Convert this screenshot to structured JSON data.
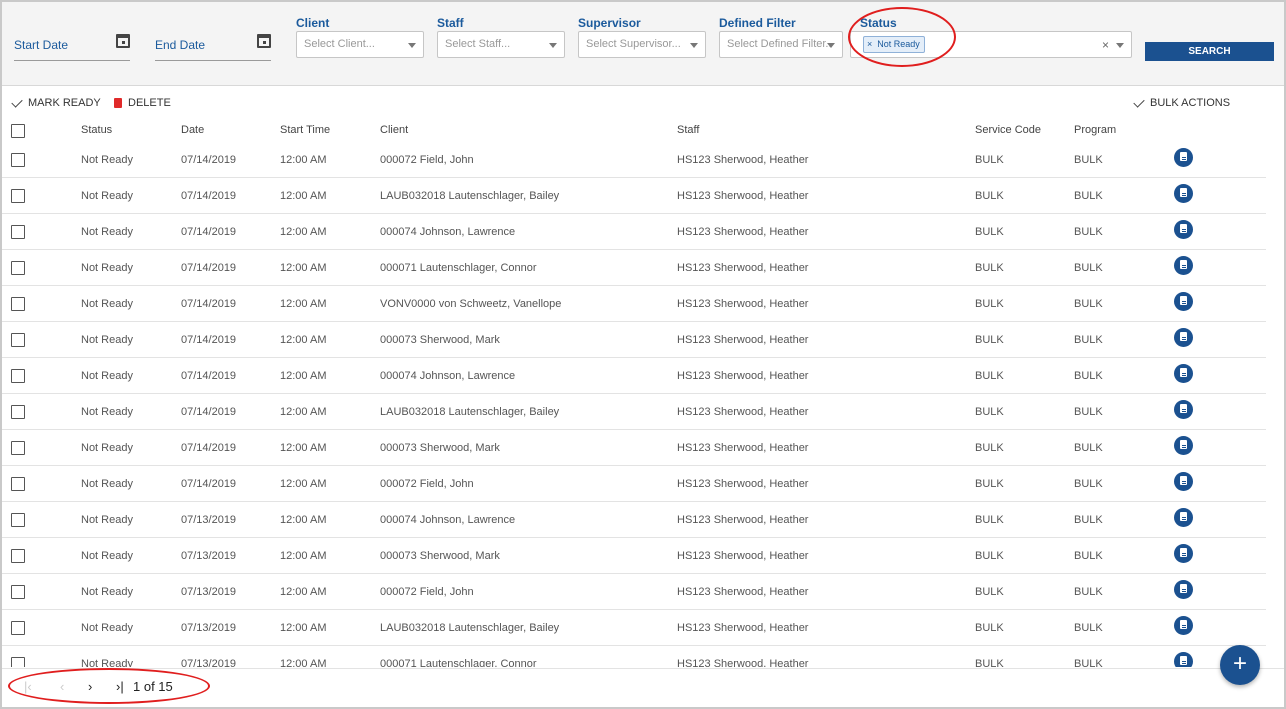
{
  "filters": {
    "start_date": {
      "label": "Start Date"
    },
    "end_date": {
      "label": "End Date"
    },
    "client": {
      "label": "Client",
      "placeholder": "Select Client..."
    },
    "staff": {
      "label": "Staff",
      "placeholder": "Select Staff..."
    },
    "supervisor": {
      "label": "Supervisor",
      "placeholder": "Select Supervisor..."
    },
    "defined_filter": {
      "label": "Defined Filter",
      "placeholder": "Select Defined Filter..."
    },
    "status": {
      "label": "Status",
      "tag": "Not Ready",
      "tag_remove": "×",
      "clear": "×"
    },
    "search_label": "SEARCH"
  },
  "toolbar": {
    "mark_ready": "MARK READY",
    "delete": "DELETE",
    "bulk_actions": "BULK ACTIONS"
  },
  "table": {
    "columns": [
      "Status",
      "Date",
      "Start Time",
      "Client",
      "Staff",
      "Service Code",
      "Program"
    ],
    "rows": [
      {
        "status": "Not Ready",
        "date": "07/14/2019",
        "start": "12:00 AM",
        "client": "000072 Field, John",
        "staff": "HS123 Sherwood, Heather",
        "service": "BULK",
        "program": "BULK"
      },
      {
        "status": "Not Ready",
        "date": "07/14/2019",
        "start": "12:00 AM",
        "client": "LAUB032018 Lautenschlager, Bailey",
        "staff": "HS123 Sherwood, Heather",
        "service": "BULK",
        "program": "BULK"
      },
      {
        "status": "Not Ready",
        "date": "07/14/2019",
        "start": "12:00 AM",
        "client": "000074 Johnson, Lawrence",
        "staff": "HS123 Sherwood, Heather",
        "service": "BULK",
        "program": "BULK"
      },
      {
        "status": "Not Ready",
        "date": "07/14/2019",
        "start": "12:00 AM",
        "client": "000071 Lautenschlager, Connor",
        "staff": "HS123 Sherwood, Heather",
        "service": "BULK",
        "program": "BULK"
      },
      {
        "status": "Not Ready",
        "date": "07/14/2019",
        "start": "12:00 AM",
        "client": "VONV0000 von Schweetz, Vanellope",
        "staff": "HS123 Sherwood, Heather",
        "service": "BULK",
        "program": "BULK"
      },
      {
        "status": "Not Ready",
        "date": "07/14/2019",
        "start": "12:00 AM",
        "client": "000073 Sherwood, Mark",
        "staff": "HS123 Sherwood, Heather",
        "service": "BULK",
        "program": "BULK"
      },
      {
        "status": "Not Ready",
        "date": "07/14/2019",
        "start": "12:00 AM",
        "client": "000074 Johnson, Lawrence",
        "staff": "HS123 Sherwood, Heather",
        "service": "BULK",
        "program": "BULK"
      },
      {
        "status": "Not Ready",
        "date": "07/14/2019",
        "start": "12:00 AM",
        "client": "LAUB032018 Lautenschlager, Bailey",
        "staff": "HS123 Sherwood, Heather",
        "service": "BULK",
        "program": "BULK"
      },
      {
        "status": "Not Ready",
        "date": "07/14/2019",
        "start": "12:00 AM",
        "client": "000073 Sherwood, Mark",
        "staff": "HS123 Sherwood, Heather",
        "service": "BULK",
        "program": "BULK"
      },
      {
        "status": "Not Ready",
        "date": "07/14/2019",
        "start": "12:00 AM",
        "client": "000072 Field, John",
        "staff": "HS123 Sherwood, Heather",
        "service": "BULK",
        "program": "BULK"
      },
      {
        "status": "Not Ready",
        "date": "07/13/2019",
        "start": "12:00 AM",
        "client": "000074 Johnson, Lawrence",
        "staff": "HS123 Sherwood, Heather",
        "service": "BULK",
        "program": "BULK"
      },
      {
        "status": "Not Ready",
        "date": "07/13/2019",
        "start": "12:00 AM",
        "client": "000073 Sherwood, Mark",
        "staff": "HS123 Sherwood, Heather",
        "service": "BULK",
        "program": "BULK"
      },
      {
        "status": "Not Ready",
        "date": "07/13/2019",
        "start": "12:00 AM",
        "client": "000072 Field, John",
        "staff": "HS123 Sherwood, Heather",
        "service": "BULK",
        "program": "BULK"
      },
      {
        "status": "Not Ready",
        "date": "07/13/2019",
        "start": "12:00 AM",
        "client": "LAUB032018 Lautenschlager, Bailey",
        "staff": "HS123 Sherwood, Heather",
        "service": "BULK",
        "program": "BULK"
      },
      {
        "status": "Not Ready",
        "date": "07/13/2019",
        "start": "12:00 AM",
        "client": "000071 Lautenschlager, Connor",
        "staff": "HS123 Sherwood, Heather",
        "service": "BULK",
        "program": "BULK"
      }
    ]
  },
  "pager": {
    "first": "|‹",
    "prev": "‹",
    "next": "›",
    "last": "›|",
    "page_info": "1 of 15"
  },
  "fab_label": "+",
  "colors": {
    "accent": "#1b5190",
    "highlight": "#e01e1e",
    "label": "#1b5a9c"
  }
}
